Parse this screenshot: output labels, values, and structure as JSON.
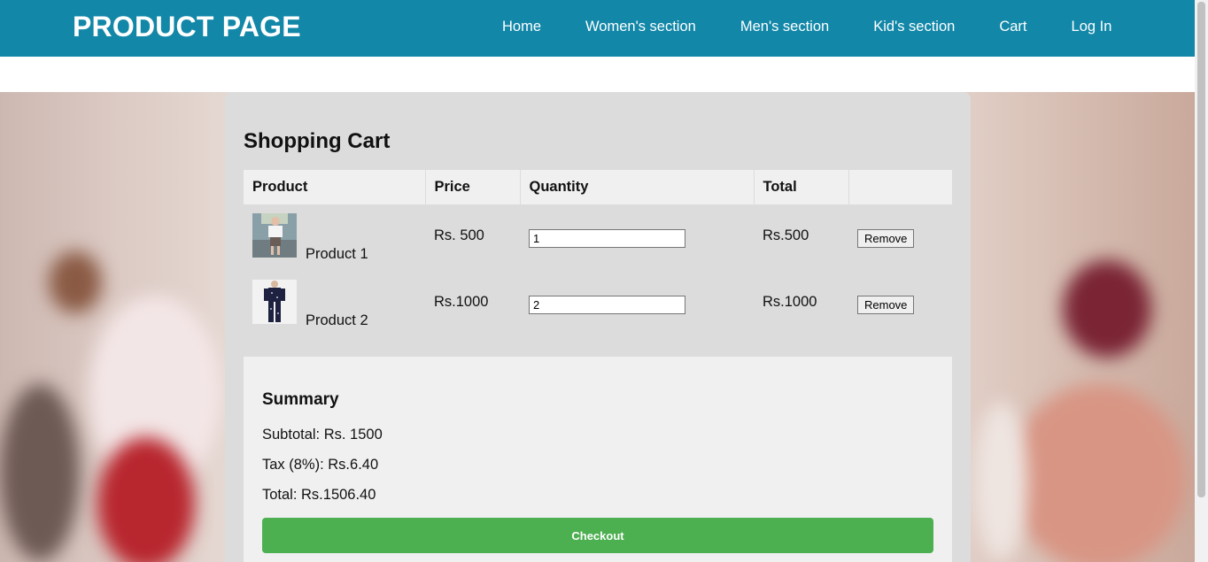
{
  "header": {
    "brand": "PRODUCT PAGE",
    "nav": [
      "Home",
      "Women's section",
      "Men's section",
      "Kid's section",
      "Cart",
      "Log In"
    ]
  },
  "cart": {
    "title": "Shopping Cart",
    "columns": [
      "Product",
      "Price",
      "Quantity",
      "Total",
      ""
    ],
    "rows": [
      {
        "name": "Product 1",
        "price": "Rs. 500",
        "quantity": "1",
        "total": "Rs.500",
        "remove_label": "Remove"
      },
      {
        "name": "Product 2",
        "price": "Rs.1000",
        "quantity": "2",
        "total": "Rs.1000",
        "remove_label": "Remove"
      }
    ]
  },
  "summary": {
    "title": "Summary",
    "subtotal": "Subtotal: Rs. 1500",
    "tax": "Tax (8%): Rs.6.40",
    "total": "Total: Rs.1506.40",
    "checkout_label": "Checkout"
  },
  "colors": {
    "header_bg": "#1287a8",
    "checkout_bg": "#4caf50"
  }
}
